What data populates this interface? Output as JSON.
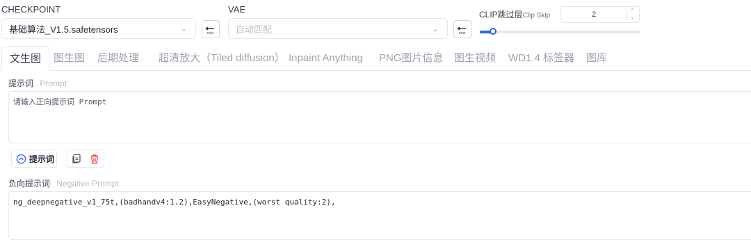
{
  "checkpoint": {
    "label": "CHECKPOINT",
    "value": "基础算法_V1.5.safetensors"
  },
  "vae": {
    "label": "VAE",
    "placeholder": "自动匹配"
  },
  "clip": {
    "label_cn": "CLIP跳过层",
    "label_en": "Clip Skip",
    "value": "2",
    "slider_fraction": 0.08
  },
  "tabs": [
    {
      "label": "文生图",
      "active": true
    },
    {
      "label": "图生图"
    },
    {
      "label": "后期处理"
    },
    {
      "label": "超清放大（Tiled diffusion）"
    },
    {
      "label": "Inpaint Anything"
    },
    {
      "label": "PNG图片信息"
    },
    {
      "label": "图生视频"
    },
    {
      "label": "WD1.4 标签器"
    },
    {
      "label": "图库"
    }
  ],
  "prompt": {
    "label_cn": "提示词",
    "label_en": "Prompt",
    "placeholder": "请输入正向提示词 Prompt"
  },
  "toolbar": {
    "toggle_label": "提示词"
  },
  "negative": {
    "label_cn": "负向提示词",
    "label_en": "Negative Prompt",
    "value": "ng_deepnegative_v1_75t,(badhandv4:1.2),EasyNegative,(worst quality:2),"
  },
  "colors": {
    "accent": "#2563eb",
    "delete": "#ef4444"
  }
}
